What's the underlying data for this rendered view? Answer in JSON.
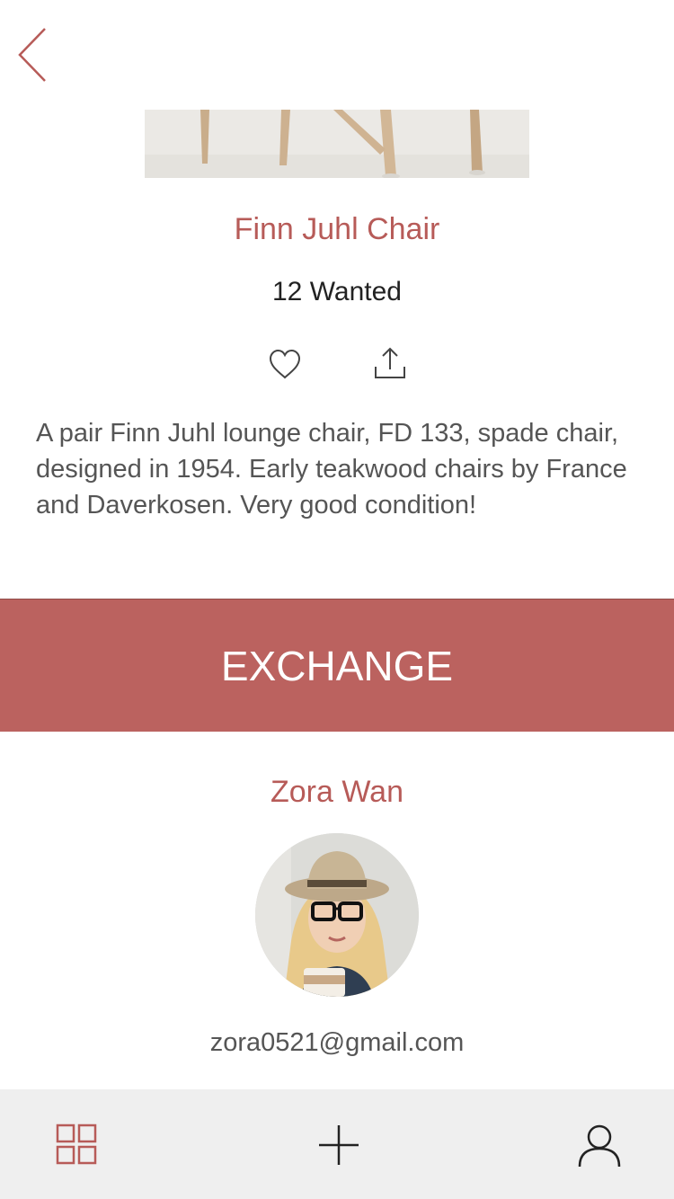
{
  "product": {
    "title": "Finn Juhl Chair",
    "wanted": "12 Wanted",
    "description": "A pair Finn Juhl lounge chair, FD 133, spade chair, designed in 1954. Early teakwood chairs by France and Daverkosen. Very good condition!"
  },
  "actions": {
    "exchange_label": "EXCHANGE"
  },
  "seller": {
    "name": "Zora Wan",
    "email": "zora0521@gmail.com"
  },
  "icons": {
    "back": "chevron-left-icon",
    "favorite": "heart-icon",
    "share": "share-icon",
    "tab_grid": "grid-icon",
    "tab_add": "plus-icon",
    "tab_profile": "user-icon"
  },
  "colors": {
    "accent": "#b75b58",
    "exchange_bg": "#bb625f",
    "tabbar_bg": "#efefef"
  }
}
